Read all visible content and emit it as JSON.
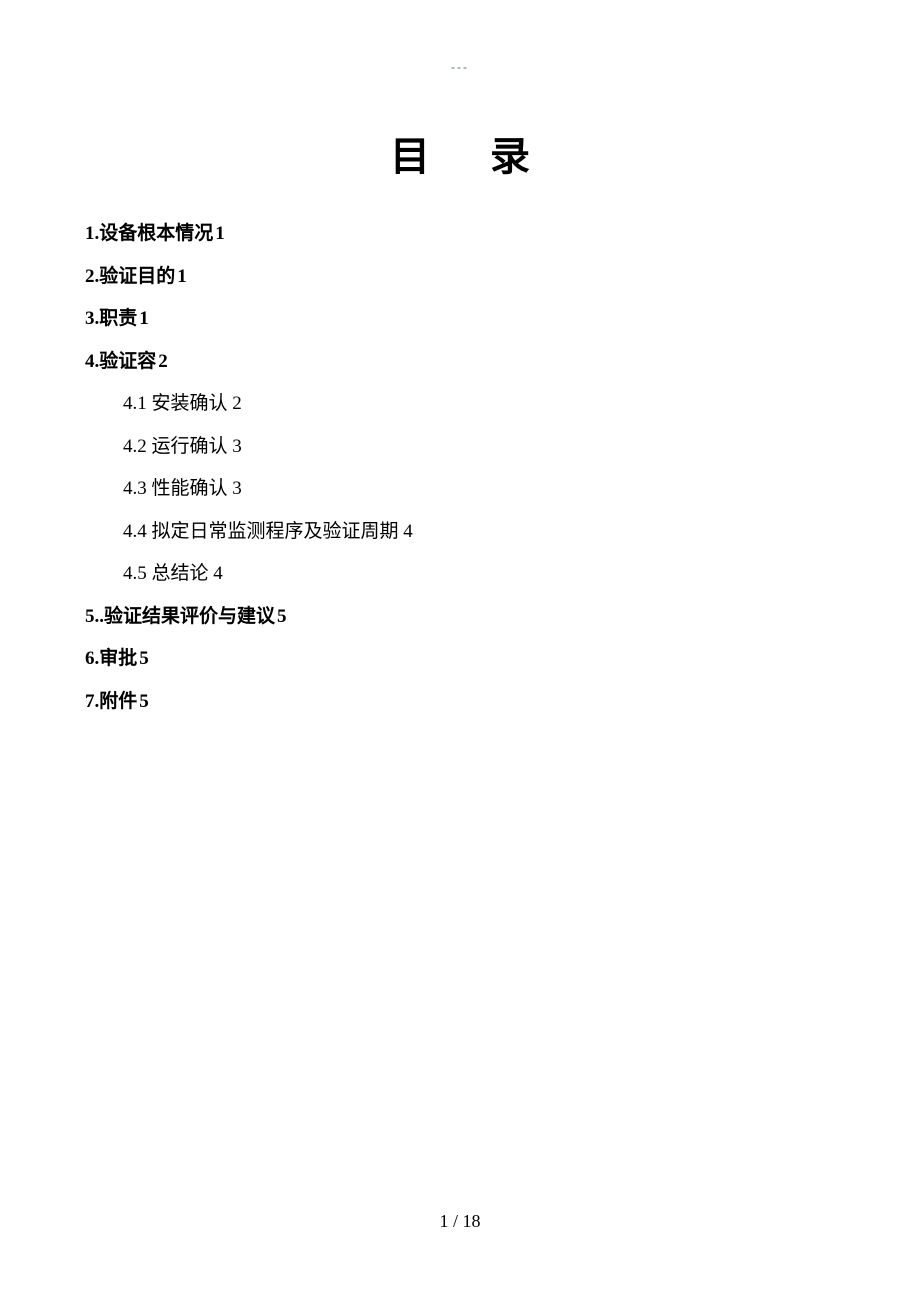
{
  "header_mark": "---",
  "title": "目录",
  "toc": {
    "items": [
      {
        "prefix": "1.",
        "label": "设备根本情况",
        "page": "1"
      },
      {
        "prefix": "2.",
        "label": "验证目的",
        "page": "1"
      },
      {
        "prefix": "3.",
        "label": "职责",
        "page": "1"
      },
      {
        "prefix": "4.",
        "label": "验证容",
        "page": "2"
      },
      {
        "prefix": "5..",
        "label": "验证结果评价与建议",
        "page": "5"
      },
      {
        "prefix": "6.",
        "label": "审批",
        "page": "5"
      },
      {
        "prefix": "7.",
        "label": "附件",
        "page": "5"
      }
    ],
    "subitems_4": [
      {
        "prefix": "4.1 ",
        "label": "安装确认",
        "page": "2"
      },
      {
        "prefix": "4.2",
        "label": "运行确认",
        "page": "3"
      },
      {
        "prefix": "4.3",
        "label": "性能确认",
        "page": "3"
      },
      {
        "prefix": "4.4",
        "label": "拟定日常监测程序及验证周期",
        "page": "4"
      },
      {
        "prefix": "4.5",
        "label": "总结论",
        "page": "4"
      }
    ]
  },
  "footer": "1 / 18"
}
